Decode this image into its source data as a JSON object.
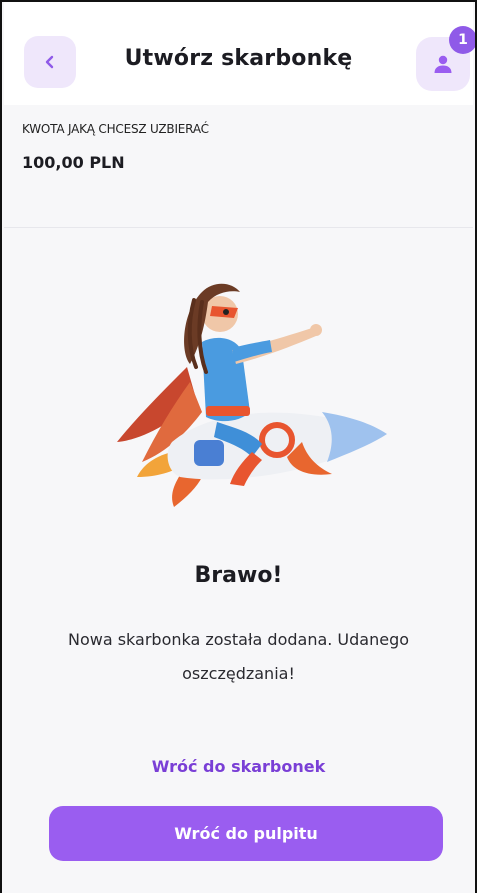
{
  "header": {
    "title": "Utwórz skarbonkę",
    "notification_count": "1"
  },
  "summary": {
    "label": "KWOTA JAKĄ CHCESZ UZBIERAĆ",
    "value": "100,00 PLN"
  },
  "success": {
    "heading": "Brawo!",
    "message": "Nowa skarbonka została dodana. Udanego oszczędzania!"
  },
  "actions": {
    "back_to_piggybanks": "Wróć do skarbonek",
    "back_to_dashboard": "Wróć do pulpitu"
  },
  "colors": {
    "accent": "#9a5df0",
    "accent_soft": "#efe7fb",
    "link": "#7a3fd6",
    "badge": "#8f5ae8"
  },
  "icons": {
    "back": "chevron-left-icon",
    "profile": "user-icon"
  }
}
